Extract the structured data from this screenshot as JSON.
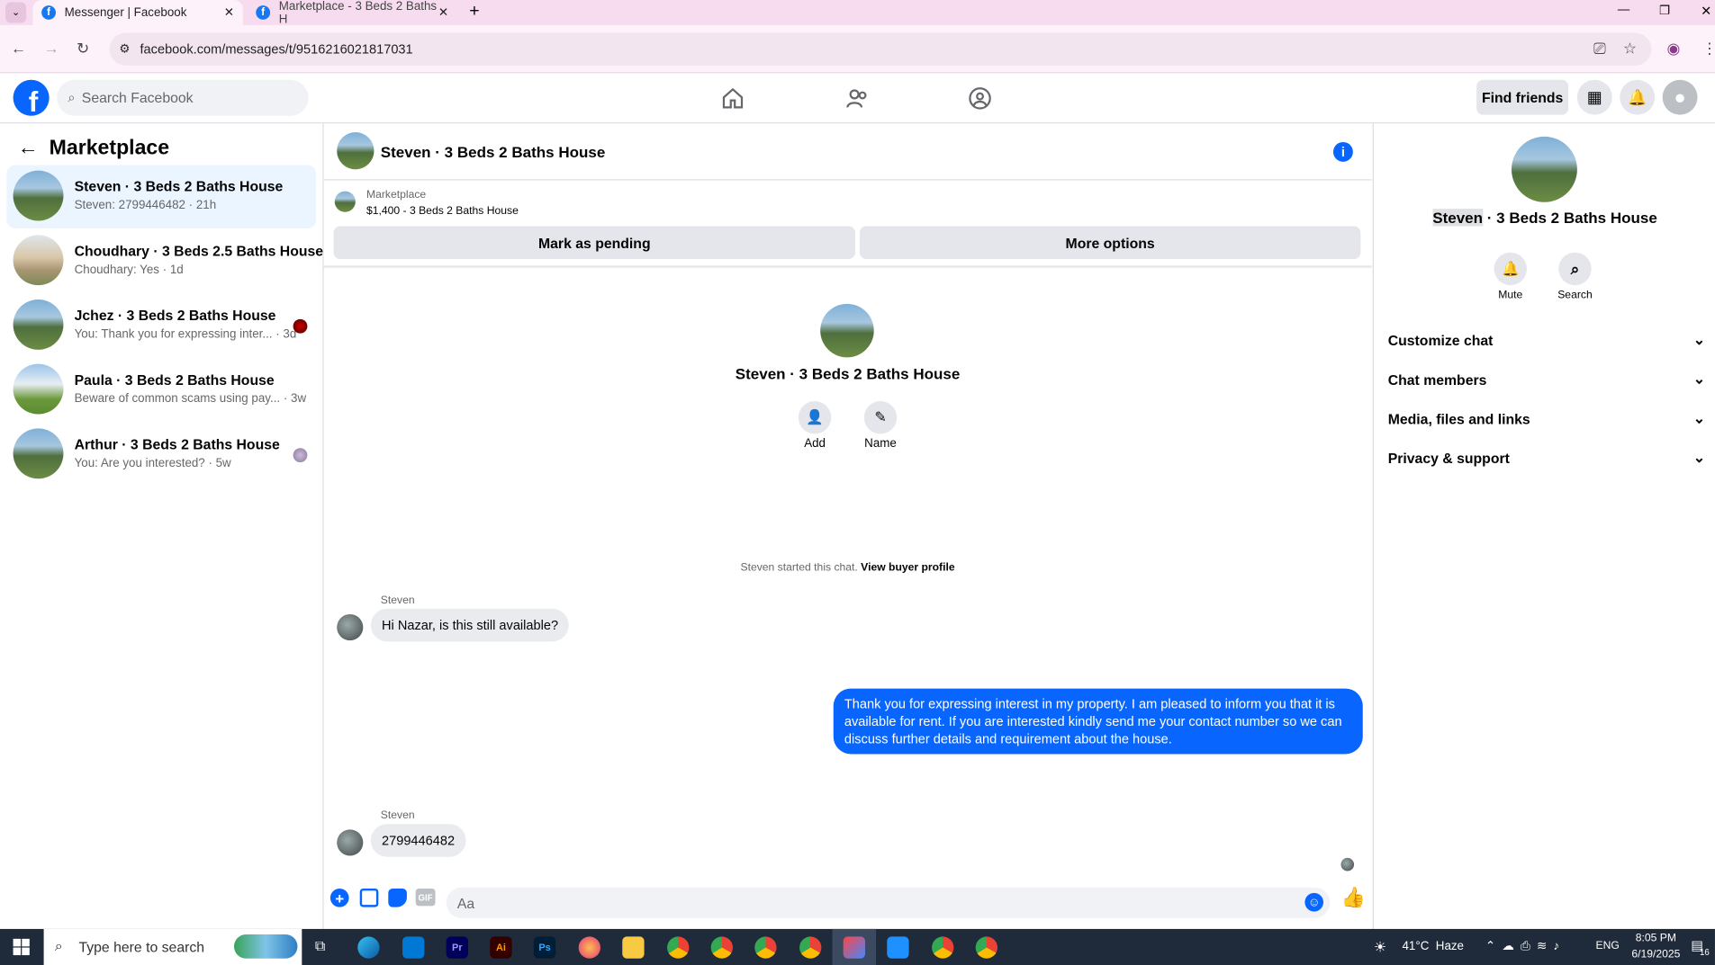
{
  "browser": {
    "tabs": [
      {
        "title": "Messenger | Facebook",
        "active": true
      },
      {
        "title": "Marketplace - 3 Beds 2 Baths H",
        "active": false
      }
    ],
    "url": "facebook.com/messages/t/9516216021817031"
  },
  "header": {
    "search_placeholder": "Search Facebook",
    "find_friends": "Find friends"
  },
  "sidebar": {
    "title": "Marketplace",
    "conversations": [
      {
        "name": "Steven · 3 Beds 2 Baths House",
        "snippet": "Steven: 2799446482 · 21h",
        "active": true
      },
      {
        "name": "Choudhary · 3 Beds 2.5 Baths House",
        "snippet": "Choudhary: Yes · 1d",
        "active": false
      },
      {
        "name": "Jchez · 3 Beds 2 Baths House",
        "snippet": "You: Thank you for expressing inter... · 3d",
        "active": false
      },
      {
        "name": "Paula · 3 Beds 2 Baths House",
        "snippet": "Beware of common scams using pay... · 3w",
        "active": false
      },
      {
        "name": "Arthur · 3 Beds 2 Baths House",
        "snippet": "You: Are you interested? · 5w",
        "active": false
      }
    ]
  },
  "chat": {
    "title": "Steven · 3 Beds 2 Baths House",
    "listing_source": "Marketplace",
    "listing_price": "$1,400 - 3 Beds 2 Baths House",
    "mark_pending": "Mark as pending",
    "more_options": "More options",
    "intro_name": "Steven · 3 Beds 2 Baths House",
    "add_label": "Add",
    "name_label": "Name",
    "started_text": "Steven started this chat.",
    "view_buyer": "View buyer profile",
    "messages": [
      {
        "sender": "Steven",
        "text": "Hi Nazar, is this still available?",
        "direction": "in"
      },
      {
        "sender": "",
        "text": "Thank you for expressing interest in my property. I am pleased to inform you that it is available for rent. If you are interested kindly send me your contact number so we can discuss further details and requirement about the house.",
        "direction": "out"
      },
      {
        "sender": "Steven",
        "text": "2799446482",
        "direction": "in"
      }
    ],
    "composer_placeholder": "Aa"
  },
  "details": {
    "name_highlight": "Steven",
    "name_rest": " · 3 Beds 2 Baths House",
    "mute_label": "Mute",
    "search_label": "Search",
    "sections": [
      "Customize chat",
      "Chat members",
      "Media, files and links",
      "Privacy & support"
    ]
  },
  "taskbar": {
    "search_placeholder": "Type here to search",
    "weather": "41°C  Haze",
    "lang": "ENG",
    "time": "8:05 PM",
    "date": "6/19/2025",
    "notif_count": "16"
  },
  "colors": {
    "fb_blue": "#0866ff",
    "active_conv": "#ebf5ff"
  }
}
